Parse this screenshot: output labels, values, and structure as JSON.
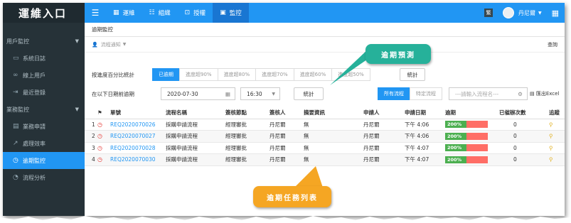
{
  "sidebar": {
    "brand": "運維入口",
    "sections": [
      {
        "label": "用戶監控",
        "items": [
          {
            "label": "系統日誌",
            "icon": "monitor-icon"
          },
          {
            "label": "線上用戶",
            "icon": "link-icon"
          },
          {
            "label": "最近登錄",
            "icon": "login-icon"
          }
        ]
      },
      {
        "label": "業務監控",
        "items": [
          {
            "label": "業務申請",
            "icon": "clipboard-icon"
          },
          {
            "label": "處理效率",
            "icon": "trend-icon"
          },
          {
            "label": "逾期監控",
            "icon": "clock-icon",
            "active": true
          },
          {
            "label": "流程分析",
            "icon": "pie-icon"
          }
        ]
      }
    ]
  },
  "topnav": {
    "tabs": [
      "運維",
      "組織",
      "授權",
      "監控"
    ],
    "active_tab": "監控",
    "badge": "繁",
    "user": "丹尼爾"
  },
  "page": {
    "breadcrumb": "逾期監控",
    "process_notice": "流程通知",
    "query_label": "查詢"
  },
  "filters": {
    "percent_label": "按進度百分比統計",
    "percent_options": [
      "已逾期",
      "進度超90%",
      "進度超80%",
      "進度超70%",
      "進度超60%",
      "進度超50%"
    ],
    "stat_button": "統計",
    "date_label": "在以下日期前逾期",
    "date_value": "2020-07-30",
    "time_value": "16:30",
    "stat_button2": "統計",
    "flow_options": [
      "所有流程",
      "特定流程"
    ],
    "flow_placeholder": "---請輸入流程名---",
    "export_label": "匯出Excel"
  },
  "table": {
    "headers": [
      "",
      "",
      "單號",
      "流程名稱",
      "簽核節點",
      "簽核人",
      "摘要資訊",
      "申請人",
      "申請日期",
      "逾期",
      "已催辦次數",
      "追蹤"
    ],
    "rows": [
      {
        "n": "1",
        "id": "REQ2020070026",
        "flow": "採購申請流程",
        "node": "經理審批",
        "signer": "丹尼爾",
        "summary": "無",
        "applicant": "丹尼爾",
        "date": "下午 4:06",
        "overdue": "200%",
        "count": "0"
      },
      {
        "n": "2",
        "id": "REQ2020070027",
        "flow": "採購申請流程",
        "node": "經理審批",
        "signer": "丹尼爾",
        "summary": "無",
        "applicant": "丹尼爾",
        "date": "下午 4:06",
        "overdue": "200%",
        "count": "0"
      },
      {
        "n": "3",
        "id": "REQ2020070028",
        "flow": "採購申請流程",
        "node": "經理審批",
        "signer": "丹尼爾",
        "summary": "無",
        "applicant": "丹尼爾",
        "date": "下午 4:07",
        "overdue": "200%",
        "count": "0"
      },
      {
        "n": "4",
        "id": "REQ2020070030",
        "flow": "採購申請流程",
        "node": "經理審批",
        "signer": "丹尼爾",
        "summary": "無",
        "applicant": "丹尼爾",
        "date": "下午 4:07",
        "overdue": "200%",
        "count": "0"
      }
    ]
  },
  "callouts": {
    "predict": "逾期預測",
    "list": "逾期任務列表"
  },
  "colors": {
    "primary": "#2196f3",
    "sidebar": "#263238",
    "callout_green": "#26b19a",
    "callout_orange": "#f5a623",
    "overdue_green": "#4caf50",
    "overdue_red": "#ff6e66"
  }
}
